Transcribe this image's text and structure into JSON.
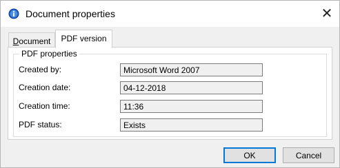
{
  "window": {
    "title": "Document properties",
    "icon": "info-icon",
    "close_glyph": "✕"
  },
  "tabs": [
    {
      "label_underlined": "D",
      "label_rest": "ocument",
      "selected": false
    },
    {
      "label": "PDF version",
      "selected": true
    }
  ],
  "group": {
    "legend": "PDF properties",
    "rows": [
      {
        "label": "Created by:",
        "value": "Microsoft Word 2007"
      },
      {
        "label": "Creation date:",
        "value": "04-12-2018"
      },
      {
        "label": "Creation time:",
        "value": "11:36"
      },
      {
        "label": "PDF status:",
        "value": "Exists"
      }
    ]
  },
  "buttons": {
    "ok": "OK",
    "cancel": "Cancel"
  },
  "colors": {
    "accent": "#0078d7",
    "dialog_bg": "#f0f0f0",
    "icon_blue": "#1e63c8"
  }
}
